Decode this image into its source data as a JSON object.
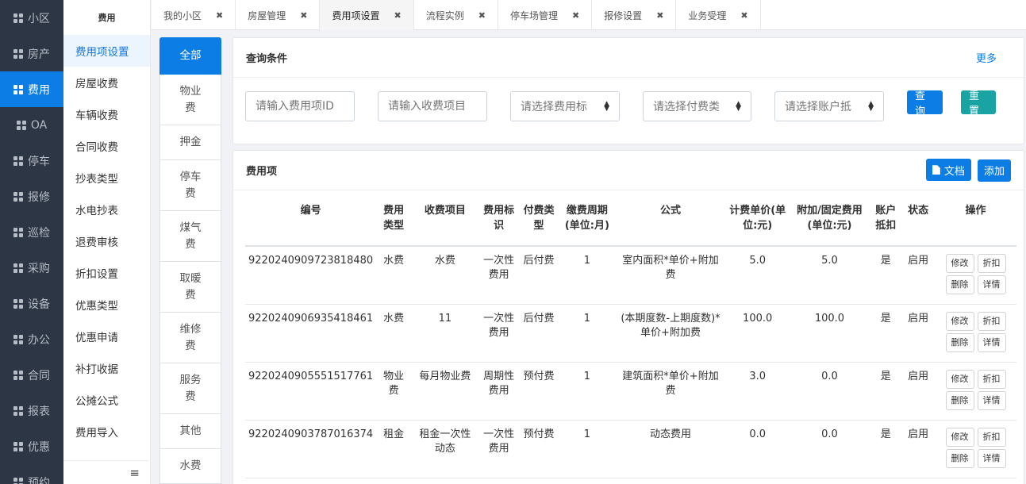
{
  "leftnav": {
    "items": [
      {
        "label": "小区",
        "active": false
      },
      {
        "label": "房产",
        "active": false
      },
      {
        "label": "费用",
        "active": true
      },
      {
        "label": "OA",
        "active": false
      },
      {
        "label": "停车",
        "active": false
      },
      {
        "label": "报修",
        "active": false
      },
      {
        "label": "巡检",
        "active": false
      },
      {
        "label": "采购",
        "active": false
      },
      {
        "label": "设备",
        "active": false
      },
      {
        "label": "办公",
        "active": false
      },
      {
        "label": "合同",
        "active": false
      },
      {
        "label": "报表",
        "active": false
      },
      {
        "label": "优惠",
        "active": false
      },
      {
        "label": "预约",
        "active": false
      }
    ]
  },
  "submenu": {
    "title": "费用",
    "items": [
      {
        "label": "费用项设置",
        "active": true
      },
      {
        "label": "房屋收费",
        "active": false
      },
      {
        "label": "车辆收费",
        "active": false
      },
      {
        "label": "合同收费",
        "active": false
      },
      {
        "label": "抄表类型",
        "active": false
      },
      {
        "label": "水电抄表",
        "active": false
      },
      {
        "label": "退费审核",
        "active": false
      },
      {
        "label": "折扣设置",
        "active": false
      },
      {
        "label": "优惠类型",
        "active": false
      },
      {
        "label": "优惠申请",
        "active": false
      },
      {
        "label": "补打收据",
        "active": false
      },
      {
        "label": "公摊公式",
        "active": false
      },
      {
        "label": "费用导入",
        "active": false
      }
    ],
    "collapse_icon": "≡"
  },
  "tabs": [
    {
      "label": "我的小区",
      "active": false
    },
    {
      "label": "房屋管理",
      "active": false
    },
    {
      "label": "费用项设置",
      "active": true
    },
    {
      "label": "流程实例",
      "active": false
    },
    {
      "label": "停车场管理",
      "active": false
    },
    {
      "label": "报修设置",
      "active": false
    },
    {
      "label": "业务受理",
      "active": false
    }
  ],
  "tab_close_glyph": "✖",
  "categories": [
    {
      "label": "全部",
      "active": true
    },
    {
      "label": "物业费",
      "active": false
    },
    {
      "label": "押金",
      "active": false
    },
    {
      "label": "停车费",
      "active": false
    },
    {
      "label": "煤气费",
      "active": false
    },
    {
      "label": "取暖费",
      "active": false
    },
    {
      "label": "维修费",
      "active": false
    },
    {
      "label": "服务费",
      "active": false
    },
    {
      "label": "其他",
      "active": false
    },
    {
      "label": "水费",
      "active": false
    }
  ],
  "query": {
    "title": "查询条件",
    "more": "更多",
    "fee_id_placeholder": "请输入费用项ID",
    "item_placeholder": "请输入收费项目",
    "fee_flag_select": "请选择费用标",
    "pay_type_select": "请选择付费类",
    "account_select": "请选择账户抵",
    "search_button": "查询",
    "reset_button": "重置"
  },
  "fee_list": {
    "title": "费用项",
    "doc_button": "文档",
    "add_button": "添加",
    "columns": [
      "编号",
      "费用类型",
      "收费项目",
      "费用标识",
      "付费类型",
      "缴费周期(单位:月)",
      "公式",
      "计费单价(单位:元)",
      "附加/固定费用(单位:元)",
      "账户抵扣",
      "状态",
      "操作"
    ],
    "rows": [
      {
        "id": "9220240909723818480",
        "fee_type": "水费",
        "item": "水费",
        "flag": "一次性费用",
        "pay_type": "后付费",
        "cycle": "1",
        "formula": "室内面积*单价+附加费",
        "unit_price": "5.0",
        "extra_fee": "5.0",
        "account": "是",
        "status": "启用"
      },
      {
        "id": "9220240906935418461",
        "fee_type": "水费",
        "item": "11",
        "flag": "一次性费用",
        "pay_type": "后付费",
        "cycle": "1",
        "formula": "(本期度数-上期度数)*单价+附加费",
        "unit_price": "100.0",
        "extra_fee": "100.0",
        "account": "是",
        "status": "启用"
      },
      {
        "id": "9220240905551517761",
        "fee_type": "物业费",
        "item": "每月物业费",
        "flag": "周期性费用",
        "pay_type": "预付费",
        "cycle": "1",
        "formula": "建筑面积*单价+附加费",
        "unit_price": "3.0",
        "extra_fee": "0.0",
        "account": "是",
        "status": "启用"
      },
      {
        "id": "9220240903787016374",
        "fee_type": "租金",
        "item": "租金一次性动态",
        "flag": "一次性费用",
        "pay_type": "预付费",
        "cycle": "1",
        "formula": "动态费用",
        "unit_price": "0.0",
        "extra_fee": "0.0",
        "account": "是",
        "status": "启用"
      }
    ],
    "op_labels": {
      "edit": "修改",
      "discount": "折扣",
      "delete": "删除",
      "detail": "详情"
    }
  },
  "colors": {
    "primary": "#0d7de6",
    "nav_bg": "#2d3644",
    "teal": "#1aa3a3"
  }
}
